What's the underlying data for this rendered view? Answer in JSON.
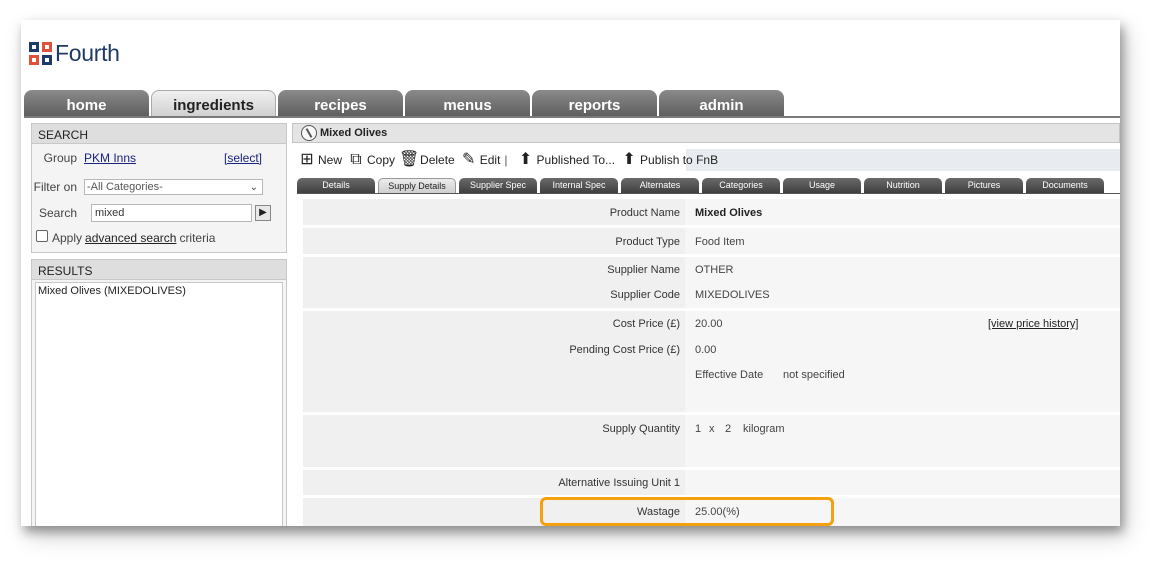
{
  "logo": {
    "text": "Fourth"
  },
  "nav": {
    "tabs": [
      {
        "label": "home"
      },
      {
        "label": "ingredients"
      },
      {
        "label": "recipes"
      },
      {
        "label": "menus"
      },
      {
        "label": "reports"
      },
      {
        "label": "admin"
      }
    ],
    "active": "ingredients"
  },
  "search": {
    "header": "SEARCH",
    "group_label": "Group",
    "group_value": "PKM Inns",
    "select_link": "[select]",
    "filter_label": "Filter on",
    "filter_value": "-All Categories-",
    "search_label": "Search",
    "search_value": "mixed",
    "go_glyph": "▶",
    "apply_prefix": "Apply",
    "advanced_link": "advanced search",
    "apply_suffix": "criteria"
  },
  "results": {
    "header": "RESULTS",
    "items": [
      "Mixed Olives (MIXEDOLIVES)"
    ]
  },
  "item": {
    "title": "Mixed Olives"
  },
  "toolbar": {
    "new": "New",
    "copy": "Copy",
    "delete": "Delete",
    "edit": "Edit",
    "published_to": "Published To...",
    "publish_fnb": "Publish to FnB"
  },
  "subtabs": [
    "Details",
    "Supply Details",
    "Supplier Spec",
    "Internal Spec",
    "Alternates",
    "Categories",
    "Usage",
    "Nutrition",
    "Pictures",
    "Documents"
  ],
  "fields": {
    "product_name_label": "Product Name",
    "product_name": "Mixed Olives",
    "product_type_label": "Product Type",
    "product_type": "Food Item",
    "supplier_name_label": "Supplier Name",
    "supplier_name": "OTHER",
    "supplier_code_label": "Supplier Code",
    "supplier_code": "MIXEDOLIVES",
    "cost_price_label": "Cost Price (£)",
    "cost_price": "20.00",
    "view_price_history": "[view price history]",
    "pending_cost_label": "Pending Cost Price (£)",
    "pending_cost": "0.00",
    "effective_date_label": "Effective Date",
    "effective_date": "not specified",
    "supply_quantity_label": "Supply Quantity",
    "sq_qty": "1",
    "sq_x": "x",
    "sq_size": "2",
    "sq_unit": "kilogram",
    "alt_issuing_label": "Alternative Issuing Unit 1",
    "wastage_label": "Wastage",
    "wastage": "25.00(%)"
  },
  "colors": {
    "highlight": "#f5a00f",
    "brand_navy": "#1f3a66",
    "brand_red": "#e0503a"
  }
}
